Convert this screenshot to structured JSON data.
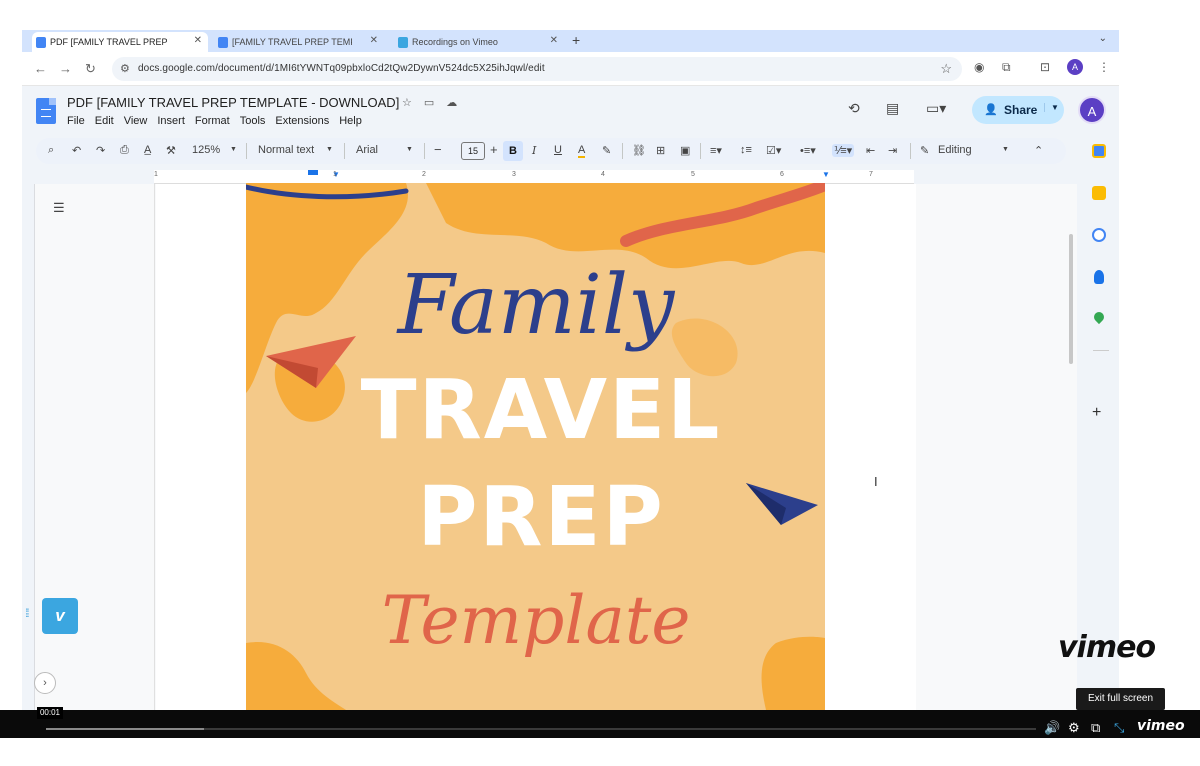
{
  "browser": {
    "tabs": [
      {
        "title": "PDF [FAMILY TRAVEL PREP T",
        "active": true,
        "icon": "google-docs-icon",
        "icon_color": "#4285f4"
      },
      {
        "title": "[FAMILY TRAVEL PREP TEMP",
        "active": false,
        "icon": "google-docs-icon",
        "icon_color": "#4285f4"
      },
      {
        "title": "Recordings on Vimeo",
        "active": false,
        "icon": "vimeo-icon",
        "icon_color": "#3ba6e0"
      }
    ],
    "new_tab": "+",
    "url": "docs.google.com/document/d/1MI6tYWNTq09pbxloCd2tQw2DywnV524dc5X25ihJqwl/edit",
    "profile_initial": "A"
  },
  "docs": {
    "title": "PDF [FAMILY TRAVEL PREP TEMPLATE - DOWNLOAD]",
    "menu": [
      "File",
      "Edit",
      "View",
      "Insert",
      "Format",
      "Tools",
      "Extensions",
      "Help"
    ],
    "share_label": "Share",
    "avatar_initial": "A",
    "toolbar": {
      "zoom": "125%",
      "style": "Normal text",
      "font": "Arial",
      "font_size": "15",
      "mode": "Editing"
    },
    "ruler_numbers": [
      "1",
      "1",
      "2",
      "3",
      "4",
      "5",
      "6",
      "7"
    ]
  },
  "cover": {
    "line1": "Family",
    "line2": "TRAVEL",
    "line3": "PREP",
    "line4": "Template",
    "colors": {
      "bg": "#f4c989",
      "map": "#f6ac3c",
      "navy": "#2c3f8c",
      "coral": "#e0654a",
      "white": "#ffffff"
    }
  },
  "player": {
    "timecode": "00:01",
    "progress": 0.16,
    "tooltip": "Exit full screen",
    "brand": "vimeo",
    "brand_small": "vimeo",
    "logo_letter": "v"
  },
  "colors": {
    "accent": "#4285f4",
    "share_bg": "#c2e7ff",
    "avatar": "#5b3fc4"
  }
}
